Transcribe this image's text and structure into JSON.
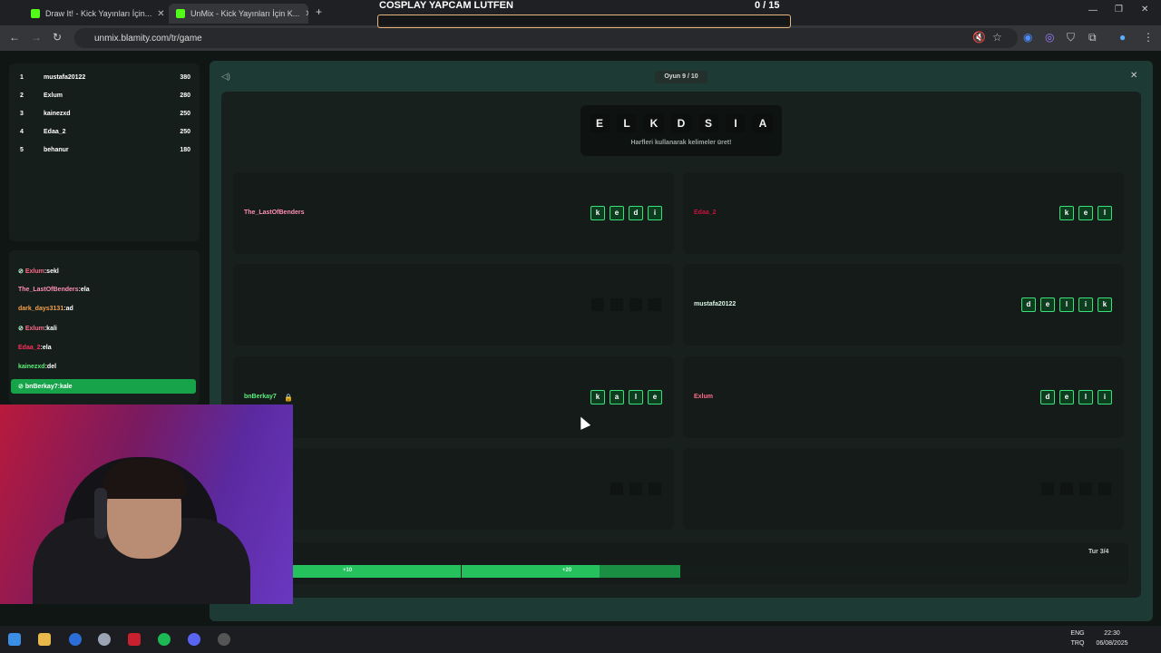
{
  "browser": {
    "tabs": [
      {
        "title": "Draw It! - Kick Yayınları İçin..."
      },
      {
        "title": "UnMix - Kick Yayınları İçin K..."
      }
    ],
    "url": "unmix.blamity.com/tr/game"
  },
  "stream_overlay": {
    "goal_title": "COSPLAY YAPCAM LUTFEN",
    "goal_count": "0 / 15"
  },
  "leaderboard": [
    {
      "rank": "1",
      "name": "mustafa20122",
      "score": "380"
    },
    {
      "rank": "2",
      "name": "Exlum",
      "score": "280"
    },
    {
      "rank": "3",
      "name": "kainezxd",
      "score": "250"
    },
    {
      "rank": "4",
      "name": "Edaa_2",
      "score": "250"
    },
    {
      "rank": "5",
      "name": "behanur",
      "score": "180"
    }
  ],
  "chat": [
    {
      "user": "Exlum",
      "msg": "sekl",
      "color": "#ff6b8a",
      "icon": true
    },
    {
      "user": "The_LastOfBenders",
      "msg": "ela",
      "color": "#ff8fb3",
      "icon": false
    },
    {
      "user": "dark_days3131",
      "msg": "ad",
      "color": "#f3a04a",
      "icon": false
    },
    {
      "user": "Exlum",
      "msg": "kali",
      "color": "#ff6b8a",
      "icon": true
    },
    {
      "user": "Edaa_2",
      "msg": "ela",
      "color": "#ff2e5a",
      "icon": false
    },
    {
      "user": "kainezxd",
      "msg": "del",
      "color": "#5bf07a",
      "icon": false
    },
    {
      "user": "bnBerkay7",
      "msg": "kale",
      "color": "#ffffff",
      "icon": true
    }
  ],
  "game": {
    "round_label": "Oyun 9 / 10",
    "letters": [
      "E",
      "L",
      "K",
      "D",
      "S",
      "I",
      "A"
    ],
    "hint": "Harfleri kullanarak kelimeler üret!",
    "turn_label": "Tur 3/4",
    "cards": [
      {
        "name": "The_LastOfBenders",
        "color": "#ff8fb3",
        "letters": [
          "k",
          "e",
          "d",
          "i"
        ],
        "locked": false
      },
      {
        "name": "Edaa_2",
        "color": "#c8123c",
        "letters": [
          "k",
          "e",
          "l"
        ],
        "locked": false
      },
      {
        "name": "",
        "color": "#ffffff",
        "letters": [
          "",
          "",
          "",
          ""
        ],
        "locked": false
      },
      {
        "name": "mustafa20122",
        "color": "#d9f5e4",
        "letters": [
          "d",
          "e",
          "l",
          "i",
          "k"
        ],
        "locked": false
      },
      {
        "name": "bnBerkay7",
        "color": "#5bf07a",
        "letters": [
          "k",
          "a",
          "l",
          "e"
        ],
        "locked": true
      },
      {
        "name": "Exlum",
        "color": "#ff6b8a",
        "letters": [
          "d",
          "e",
          "l",
          "i"
        ],
        "locked": false
      },
      {
        "name": "",
        "color": "#ffffff",
        "letters": [
          "",
          "",
          ""
        ],
        "locked": false
      },
      {
        "name": "",
        "color": "#ffffff",
        "letters": [
          "",
          "",
          "",
          ""
        ],
        "locked": false
      }
    ],
    "progress_labels": [
      "+10",
      "+20"
    ]
  },
  "taskbar": {
    "lang_line1": "ENG",
    "lang_line2": "TRQ",
    "time": "22:30",
    "date": "06/08/2025"
  }
}
